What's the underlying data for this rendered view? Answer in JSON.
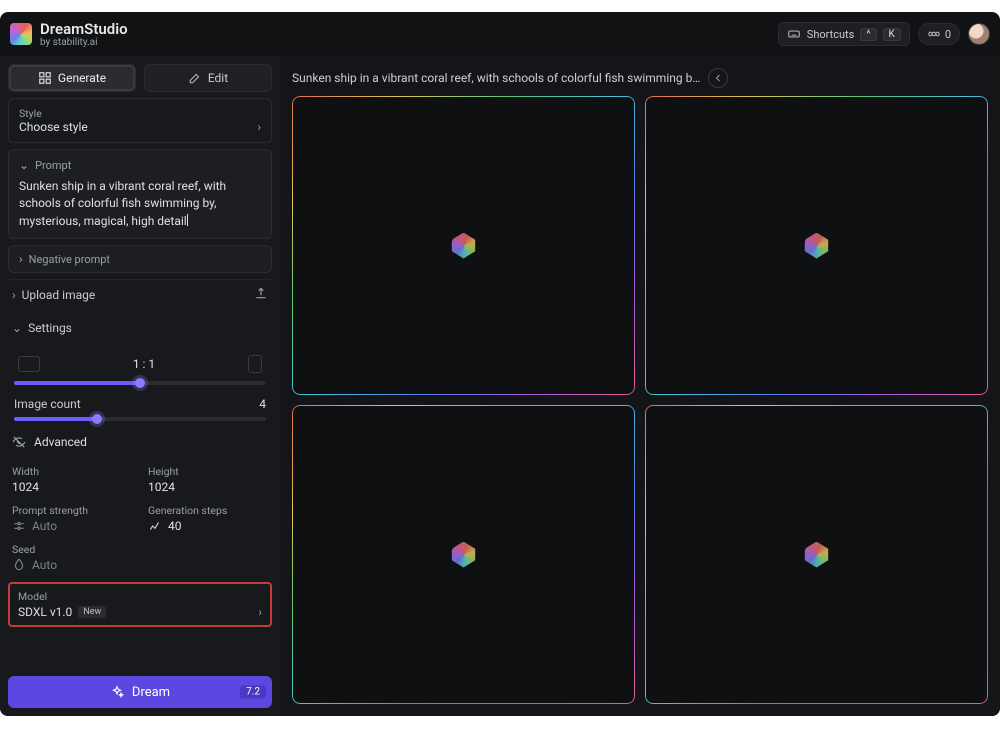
{
  "header": {
    "brand": "DreamStudio",
    "byline": "by stability.ai",
    "shortcuts_label": "Shortcuts",
    "key1": "^",
    "key2": "K",
    "credits": "0"
  },
  "tabs": {
    "generate": "Generate",
    "edit": "Edit"
  },
  "style": {
    "label": "Style",
    "value": "Choose style"
  },
  "prompt": {
    "label": "Prompt",
    "text": "Sunken ship in a vibrant coral reef, with schools of colorful fish swimming by, mysterious, magical, high detail"
  },
  "negative": {
    "label": "Negative prompt"
  },
  "upload": {
    "label": "Upload image"
  },
  "settings": {
    "label": "Settings",
    "aspect_label": "1 : 1",
    "image_count_label": "Image count",
    "image_count_value": "4",
    "advanced_label": "Advanced",
    "width_label": "Width",
    "width_value": "1024",
    "height_label": "Height",
    "height_value": "1024",
    "prompt_strength_label": "Prompt strength",
    "prompt_strength_value": "Auto",
    "gen_steps_label": "Generation steps",
    "gen_steps_value": "40",
    "seed_label": "Seed",
    "seed_value": "Auto",
    "model_label": "Model",
    "model_value": "SDXL v1.0",
    "model_badge": "New"
  },
  "dream": {
    "label": "Dream",
    "cost": "7.2"
  },
  "canvas": {
    "title": "Sunken ship in a vibrant coral reef, with schools of colorful fish swimming b…"
  }
}
